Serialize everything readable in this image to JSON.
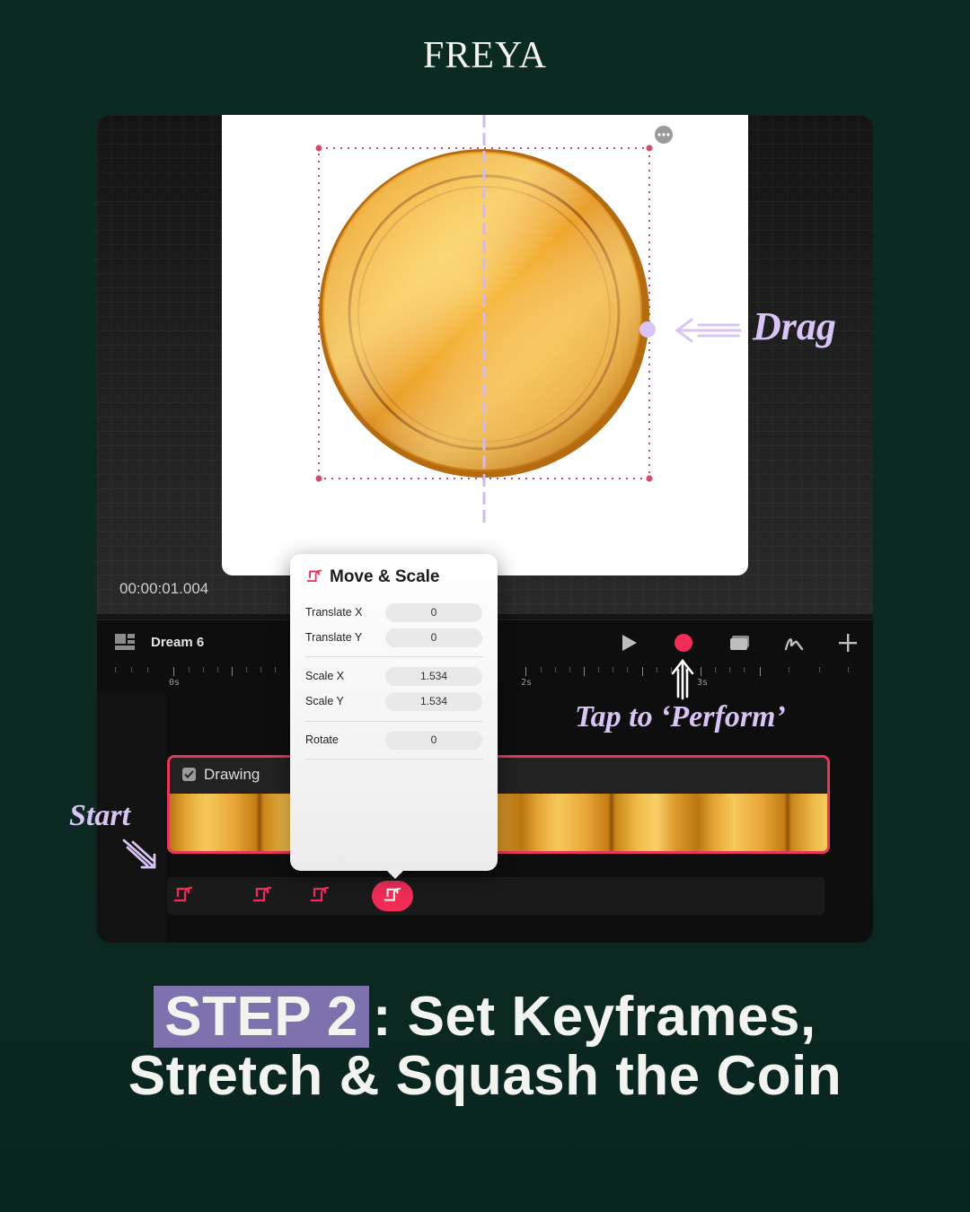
{
  "brand": "FREYA",
  "preview": {
    "timecode": "00:00:01.004"
  },
  "timeline": {
    "project_name": "Dream 6",
    "ruler_labels": [
      "0s",
      "2s",
      "3s"
    ],
    "track_label": "Drawing"
  },
  "popup": {
    "title": "Move & Scale",
    "rows": [
      {
        "label": "Translate X",
        "value": "0"
      },
      {
        "label": "Translate Y",
        "value": "0"
      },
      {
        "label": "Scale X",
        "value": "1.534"
      },
      {
        "label": "Scale Y",
        "value": "1.534"
      },
      {
        "label": "Rotate",
        "value": "0"
      }
    ]
  },
  "annotations": {
    "drag": "Drag",
    "perform": "Tap to ‘Perform’",
    "start": "Start"
  },
  "footer": {
    "step": "STEP 2",
    "line1_rest": ": Set Keyframes,",
    "line2": "Stretch & Squash the Coin"
  },
  "colors": {
    "background": "#0a2a22",
    "accent_pink": "#f12d57",
    "annotation_lavender": "#d8c4f5",
    "step_highlight": "#7d72ad"
  },
  "icons": [
    "more-icon",
    "project-icon",
    "play-icon",
    "record-icon",
    "layers-icon",
    "draw-icon",
    "add-icon",
    "move-scale-icon",
    "keyframe-icon",
    "checkbox-icon"
  ]
}
